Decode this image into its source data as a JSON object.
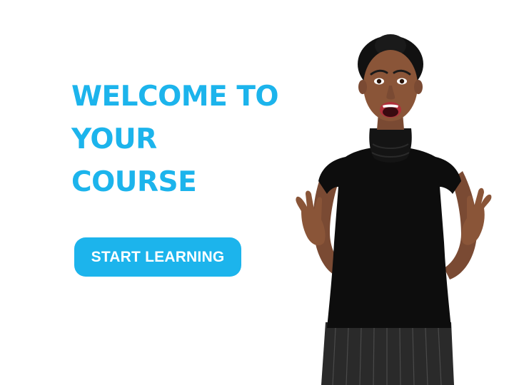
{
  "headline": {
    "line1": "WELCOME TO",
    "line2": "YOUR",
    "line3": "COURSE"
  },
  "cta": {
    "label": "START LEARNING"
  },
  "colors": {
    "accent": "#1cb4ec",
    "background": "#ffffff",
    "button_text": "#ffffff"
  },
  "image": {
    "subject": "excited-woman-photo"
  }
}
